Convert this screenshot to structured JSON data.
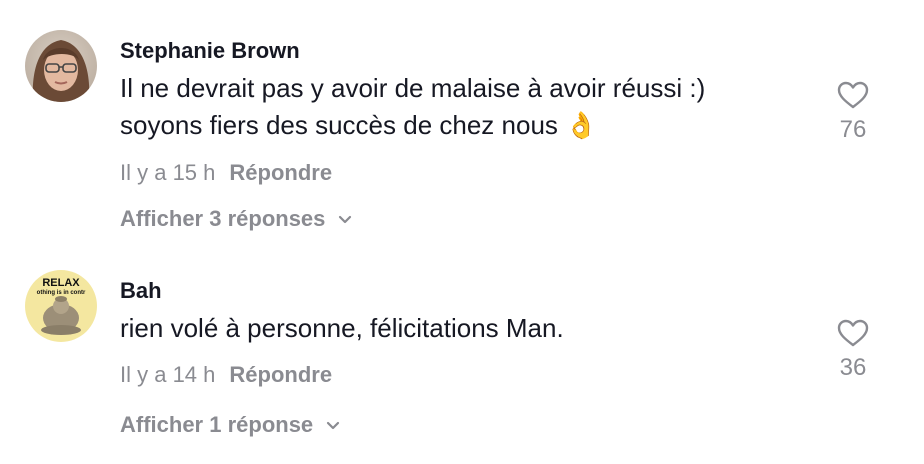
{
  "comments": [
    {
      "username": "Stephanie Brown",
      "avatar": "avatar-photo-woman-glasses",
      "text_lines": [
        "Il ne devrait pas y avoir de malaise à avoir réussi :)",
        "soyons fiers des succès de chez nous 👌"
      ],
      "time": "Il y a 15 h",
      "reply_label": "Répondre",
      "view_replies": "Afficher 3 réponses",
      "likes": "76",
      "heart_icon": "heart-outline-icon"
    },
    {
      "username": "Bah",
      "avatar": "avatar-relax-buddha",
      "avatar_text_top": "RELAX",
      "avatar_text_sub": "othing is in contr",
      "text_lines": [
        "rien volé à personne, félicitations Man."
      ],
      "time": "Il y a 14 h",
      "reply_label": "Répondre",
      "view_replies": "Afficher 1 réponse",
      "likes": "36",
      "heart_icon": "heart-outline-icon"
    }
  ],
  "colors": {
    "text": "#161823",
    "muted": "#8a8b91",
    "background": "#ffffff"
  }
}
